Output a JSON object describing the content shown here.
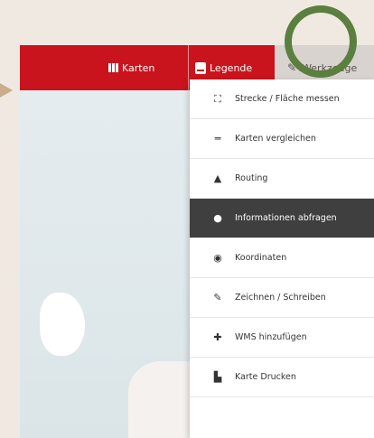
{
  "toolbar": {
    "karten_label": "Karten",
    "legende_label": "Legende",
    "werkzeuge_label": "Werkzeuge"
  },
  "menu": {
    "items": [
      {
        "label": "Strecke / Fläche messen",
        "icon": "measure-icon"
      },
      {
        "label": "Karten vergleichen",
        "icon": "compare-icon"
      },
      {
        "label": "Routing",
        "icon": "routing-icon"
      },
      {
        "label": "Informationen abfragen",
        "icon": "info-icon",
        "active": true
      },
      {
        "label": "Koordinaten",
        "icon": "coordinates-icon"
      },
      {
        "label": "Zeichnen / Schreiben",
        "icon": "pencil-icon"
      },
      {
        "label": "WMS hinzufügen",
        "icon": "plus-icon"
      },
      {
        "label": "Karte Drucken",
        "icon": "print-icon"
      }
    ]
  },
  "colors": {
    "toolbar_bg": "#c9141d",
    "active_item_bg": "#3f3f3f",
    "highlight_ring": "#5a7f3e"
  }
}
